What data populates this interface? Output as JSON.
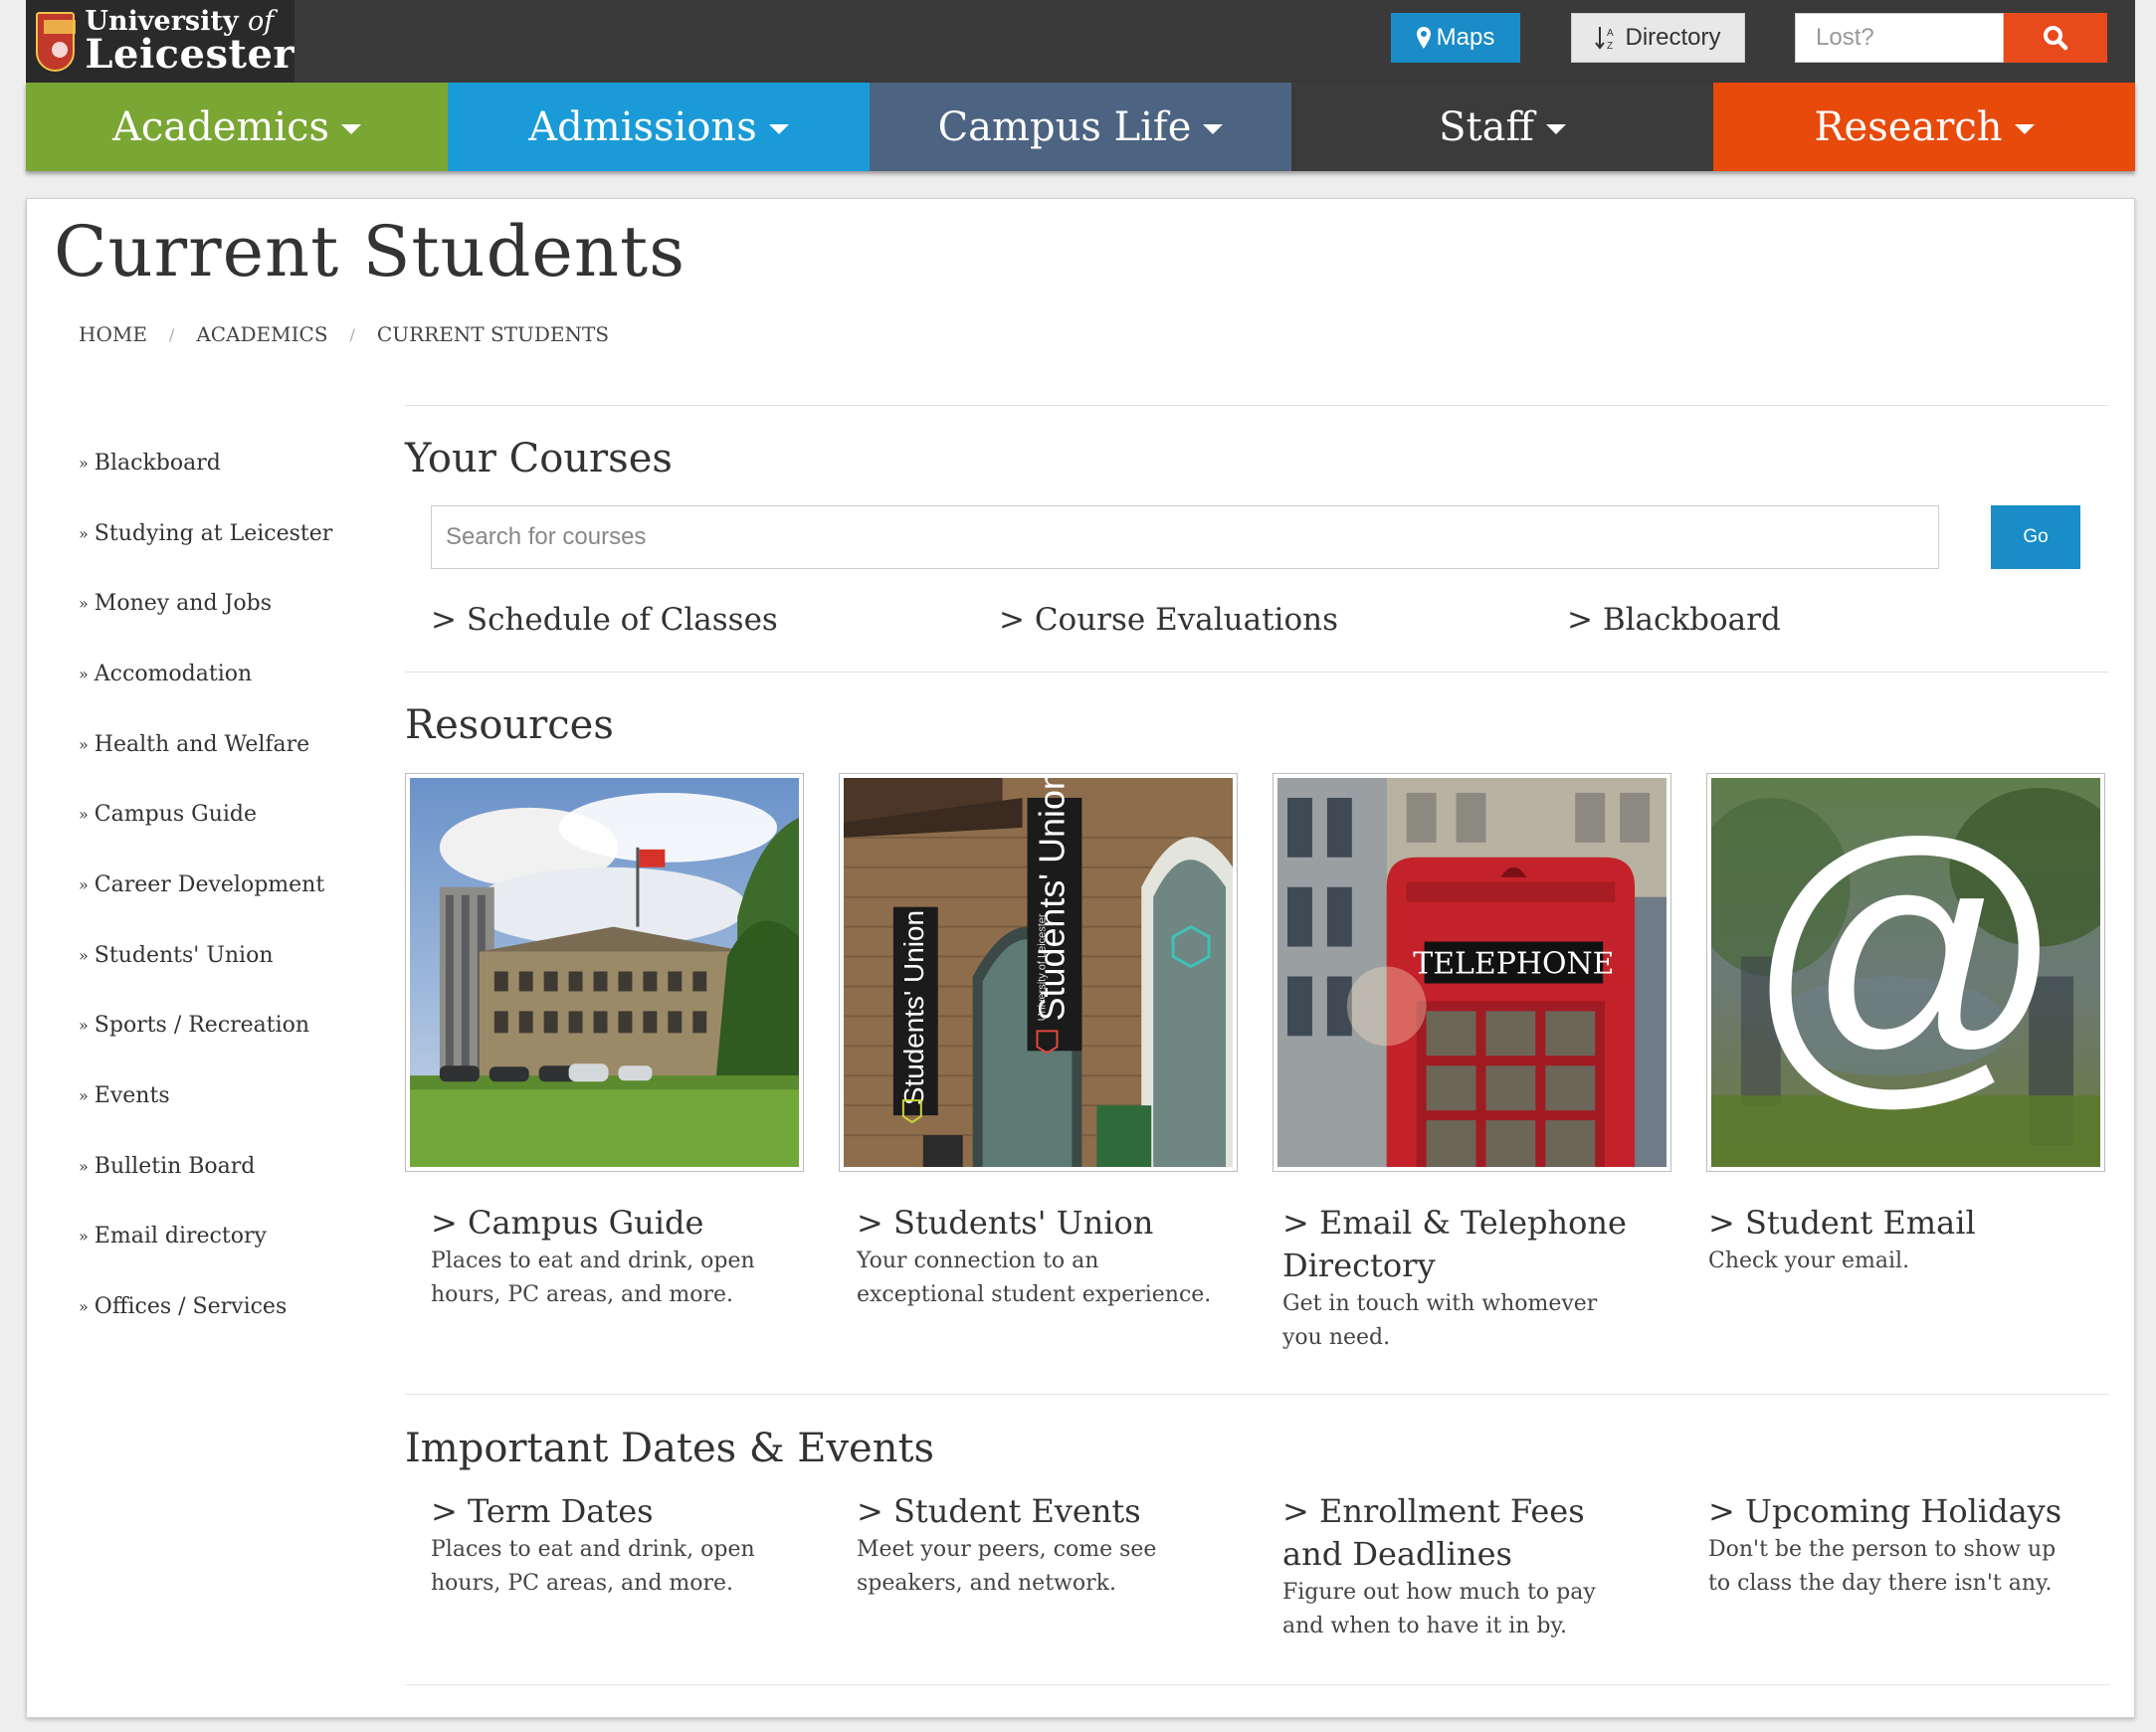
{
  "logo": {
    "line1": "University",
    "of": "of",
    "line2": "Leicester"
  },
  "topbar": {
    "maps_label": "Maps",
    "directory_label": "Directory",
    "lost_placeholder": "Lost?"
  },
  "nav": [
    {
      "label": "Academics",
      "color": "#7aa634"
    },
    {
      "label": "Admissions",
      "color": "#1a9bd7"
    },
    {
      "label": "Campus Life",
      "color": "#4c6482"
    },
    {
      "label": "Staff",
      "color": "#3b3b3b"
    },
    {
      "label": "Research",
      "color": "#e84a0c"
    }
  ],
  "page_title": "Current Students",
  "breadcrumb": [
    "HOME",
    "ACADEMICS",
    "CURRENT STUDENTS"
  ],
  "breadcrumb_sep": "/",
  "sidebar_arrow": "»",
  "sidebar": [
    "Blackboard",
    "Studying at Leicester",
    "Money and Jobs",
    "Accomodation",
    "Health and Welfare",
    "Campus Guide",
    "Career Development",
    "Students' Union",
    "Sports / Recreation",
    "Events",
    "Bulletin Board",
    "Email directory",
    "Offices / Services"
  ],
  "your_courses": {
    "title": "Your Courses",
    "search_placeholder": "Search for courses",
    "go_label": "Go",
    "links": [
      "> Schedule of Classes",
      "> Course Evaluations",
      "> Blackboard"
    ]
  },
  "resources": {
    "title": "Resources",
    "cards": [
      {
        "title": "> Campus Guide",
        "desc": "Places to eat and drink, open hours, PC areas, and more.",
        "image": "campus-building-photo"
      },
      {
        "title": "> Students' Union",
        "desc": "Your connection to an exceptional student experience.",
        "image": "students-union-photo",
        "banner1": "Students' Union",
        "banner2": "Students' Union",
        "banner_small": "University of Leicester"
      },
      {
        "title": "> Email & Telephone Directory",
        "desc": "Get in touch with whomever you need.",
        "image": "telephone-box-photo",
        "sign": "TELEPHONE"
      },
      {
        "title": "> Student Email",
        "desc": "Check your email.",
        "image": "at-sign-photo",
        "symbol": "@"
      }
    ]
  },
  "dates": {
    "title": "Important Dates & Events",
    "cards": [
      {
        "title": "> Term Dates",
        "desc": "Places to eat and drink, open hours, PC areas, and more."
      },
      {
        "title": "> Student Events",
        "desc": "Meet your peers, come see speakers, and network."
      },
      {
        "title": "> Enrollment Fees and Deadlines",
        "desc": "Figure out how much to pay and when to have it in by."
      },
      {
        "title": "> Upcoming Holidays",
        "desc": "Don't be the person to show up to class the day there isn't any."
      }
    ]
  }
}
